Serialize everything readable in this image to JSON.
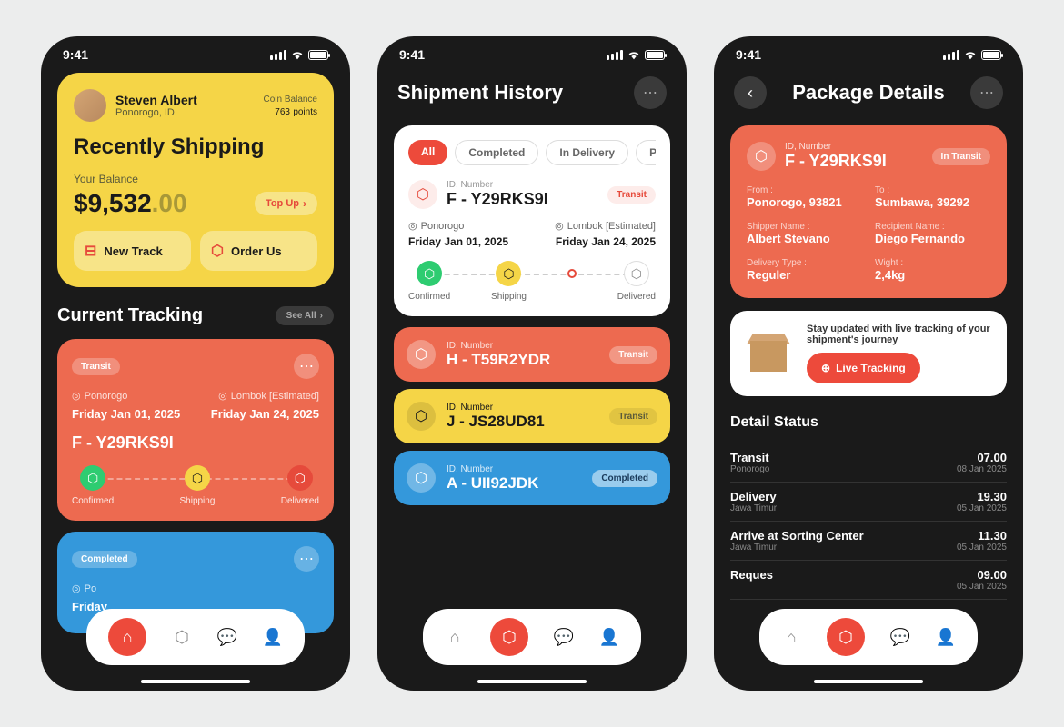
{
  "status_time": "9:41",
  "s1": {
    "profile": {
      "name": "Steven Albert",
      "location": "Ponorogo, ID"
    },
    "coin": {
      "label": "Coin Balance",
      "value": "763",
      "unit": "points"
    },
    "recent_title": "Recently Shipping",
    "balance": {
      "label": "Your Balance",
      "int": "$9,532",
      "dec": ".00"
    },
    "topup": "Top Up",
    "new_track": "New Track",
    "order_us": "Order Us",
    "tracking_title": "Current Tracking",
    "see_all": "See All",
    "card1": {
      "status": "Transit",
      "from": "Ponorogo",
      "to": "Lombok [Estimated]",
      "from_date": "Friday Jan 01, 2025",
      "to_date": "Friday Jan 24, 2025",
      "id": "F - Y29RKS9I",
      "s_confirmed": "Confirmed",
      "s_shipping": "Shipping",
      "s_delivered": "Delivered"
    },
    "card2": {
      "status": "Completed",
      "from": "Po",
      "date": "Friday"
    }
  },
  "s2": {
    "title": "Shipment History",
    "chips": {
      "all": "All",
      "completed": "Completed",
      "in_delivery": "In Delivery",
      "pending": "Pending"
    },
    "f": {
      "id_lbl": "ID, Number",
      "id": "F - Y29RKS9I",
      "pill": "Transit",
      "from": "Ponorogo",
      "to": "Lombok [Estimated]",
      "from_date": "Friday Jan 01, 2025",
      "to_date": "Friday Jan 24, 2025",
      "s_confirmed": "Confirmed",
      "s_shipping": "Shipping",
      "s_delivered": "Delivered"
    },
    "h": {
      "id_lbl": "ID, Number",
      "id": "H - T59R2YDR",
      "pill": "Transit"
    },
    "j": {
      "id_lbl": "ID, Number",
      "id": "J - JS28UD81",
      "pill": "Transit"
    },
    "a": {
      "id_lbl": "ID, Number",
      "id": "A - UII92JDK",
      "pill": "Completed"
    }
  },
  "s3": {
    "title": "Package Details",
    "card": {
      "id_lbl": "ID, Number",
      "id": "F - Y29RKS9I",
      "pill": "In Transit",
      "from_l": "From :",
      "from_v": "Ponorogo, 93821",
      "to_l": "To :",
      "to_v": "Sumbawa, 39292",
      "shipper_l": "Shipper Name :",
      "shipper_v": "Albert Stevano",
      "recip_l": "Recipient Name :",
      "recip_v": "Diego Fernando",
      "dtype_l": "Delivery Type :",
      "dtype_v": "Reguler",
      "wt_l": "Wight :",
      "wt_v": "2,4kg"
    },
    "lt_text": "Stay updated with live tracking of your shipment's journey",
    "lt_btn": "Live Tracking",
    "ds_title": "Detail Status",
    "rows": [
      {
        "l": "Transit",
        "sl": "Ponorogo",
        "r": "07.00",
        "sr": "08 Jan 2025"
      },
      {
        "l": "Delivery",
        "sl": "Jawa Timur",
        "r": "19.30",
        "sr": "05 Jan 2025"
      },
      {
        "l": "Arrive at Sorting Center",
        "sl": "Jawa Timur",
        "r": "11.30",
        "sr": "05 Jan 2025"
      },
      {
        "l": "Reques",
        "sl": "",
        "r": "09.00",
        "sr": "05 Jan 2025"
      }
    ]
  }
}
